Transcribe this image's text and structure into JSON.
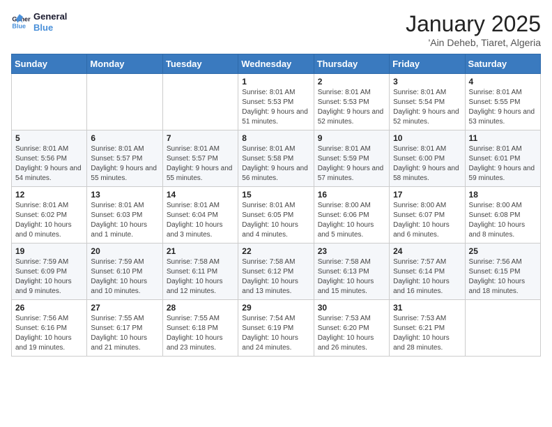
{
  "logo": {
    "line1": "General",
    "line2": "Blue"
  },
  "title": "January 2025",
  "location": "'Ain Deheb, Tiaret, Algeria",
  "weekdays": [
    "Sunday",
    "Monday",
    "Tuesday",
    "Wednesday",
    "Thursday",
    "Friday",
    "Saturday"
  ],
  "weeks": [
    [
      {
        "day": "",
        "info": ""
      },
      {
        "day": "",
        "info": ""
      },
      {
        "day": "",
        "info": ""
      },
      {
        "day": "1",
        "info": "Sunrise: 8:01 AM\nSunset: 5:53 PM\nDaylight: 9 hours and 51 minutes."
      },
      {
        "day": "2",
        "info": "Sunrise: 8:01 AM\nSunset: 5:53 PM\nDaylight: 9 hours and 52 minutes."
      },
      {
        "day": "3",
        "info": "Sunrise: 8:01 AM\nSunset: 5:54 PM\nDaylight: 9 hours and 52 minutes."
      },
      {
        "day": "4",
        "info": "Sunrise: 8:01 AM\nSunset: 5:55 PM\nDaylight: 9 hours and 53 minutes."
      }
    ],
    [
      {
        "day": "5",
        "info": "Sunrise: 8:01 AM\nSunset: 5:56 PM\nDaylight: 9 hours and 54 minutes."
      },
      {
        "day": "6",
        "info": "Sunrise: 8:01 AM\nSunset: 5:57 PM\nDaylight: 9 hours and 55 minutes."
      },
      {
        "day": "7",
        "info": "Sunrise: 8:01 AM\nSunset: 5:57 PM\nDaylight: 9 hours and 55 minutes."
      },
      {
        "day": "8",
        "info": "Sunrise: 8:01 AM\nSunset: 5:58 PM\nDaylight: 9 hours and 56 minutes."
      },
      {
        "day": "9",
        "info": "Sunrise: 8:01 AM\nSunset: 5:59 PM\nDaylight: 9 hours and 57 minutes."
      },
      {
        "day": "10",
        "info": "Sunrise: 8:01 AM\nSunset: 6:00 PM\nDaylight: 9 hours and 58 minutes."
      },
      {
        "day": "11",
        "info": "Sunrise: 8:01 AM\nSunset: 6:01 PM\nDaylight: 9 hours and 59 minutes."
      }
    ],
    [
      {
        "day": "12",
        "info": "Sunrise: 8:01 AM\nSunset: 6:02 PM\nDaylight: 10 hours and 0 minutes."
      },
      {
        "day": "13",
        "info": "Sunrise: 8:01 AM\nSunset: 6:03 PM\nDaylight: 10 hours and 1 minute."
      },
      {
        "day": "14",
        "info": "Sunrise: 8:01 AM\nSunset: 6:04 PM\nDaylight: 10 hours and 3 minutes."
      },
      {
        "day": "15",
        "info": "Sunrise: 8:01 AM\nSunset: 6:05 PM\nDaylight: 10 hours and 4 minutes."
      },
      {
        "day": "16",
        "info": "Sunrise: 8:00 AM\nSunset: 6:06 PM\nDaylight: 10 hours and 5 minutes."
      },
      {
        "day": "17",
        "info": "Sunrise: 8:00 AM\nSunset: 6:07 PM\nDaylight: 10 hours and 6 minutes."
      },
      {
        "day": "18",
        "info": "Sunrise: 8:00 AM\nSunset: 6:08 PM\nDaylight: 10 hours and 8 minutes."
      }
    ],
    [
      {
        "day": "19",
        "info": "Sunrise: 7:59 AM\nSunset: 6:09 PM\nDaylight: 10 hours and 9 minutes."
      },
      {
        "day": "20",
        "info": "Sunrise: 7:59 AM\nSunset: 6:10 PM\nDaylight: 10 hours and 10 minutes."
      },
      {
        "day": "21",
        "info": "Sunrise: 7:58 AM\nSunset: 6:11 PM\nDaylight: 10 hours and 12 minutes."
      },
      {
        "day": "22",
        "info": "Sunrise: 7:58 AM\nSunset: 6:12 PM\nDaylight: 10 hours and 13 minutes."
      },
      {
        "day": "23",
        "info": "Sunrise: 7:58 AM\nSunset: 6:13 PM\nDaylight: 10 hours and 15 minutes."
      },
      {
        "day": "24",
        "info": "Sunrise: 7:57 AM\nSunset: 6:14 PM\nDaylight: 10 hours and 16 minutes."
      },
      {
        "day": "25",
        "info": "Sunrise: 7:56 AM\nSunset: 6:15 PM\nDaylight: 10 hours and 18 minutes."
      }
    ],
    [
      {
        "day": "26",
        "info": "Sunrise: 7:56 AM\nSunset: 6:16 PM\nDaylight: 10 hours and 19 minutes."
      },
      {
        "day": "27",
        "info": "Sunrise: 7:55 AM\nSunset: 6:17 PM\nDaylight: 10 hours and 21 minutes."
      },
      {
        "day": "28",
        "info": "Sunrise: 7:55 AM\nSunset: 6:18 PM\nDaylight: 10 hours and 23 minutes."
      },
      {
        "day": "29",
        "info": "Sunrise: 7:54 AM\nSunset: 6:19 PM\nDaylight: 10 hours and 24 minutes."
      },
      {
        "day": "30",
        "info": "Sunrise: 7:53 AM\nSunset: 6:20 PM\nDaylight: 10 hours and 26 minutes."
      },
      {
        "day": "31",
        "info": "Sunrise: 7:53 AM\nSunset: 6:21 PM\nDaylight: 10 hours and 28 minutes."
      },
      {
        "day": "",
        "info": ""
      }
    ]
  ]
}
